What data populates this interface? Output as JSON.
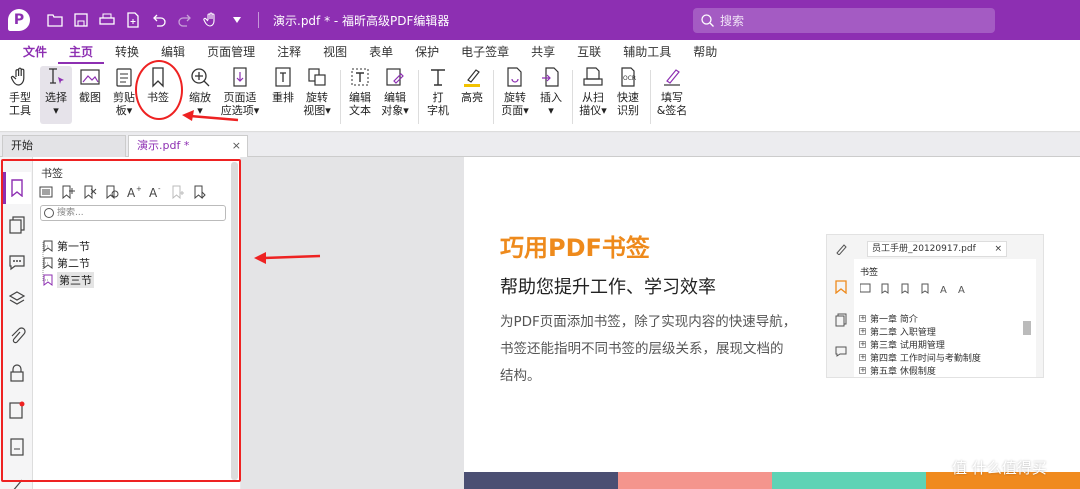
{
  "titlebar": {
    "logo": "P",
    "title": "演示.pdf * - 福昕高级PDF编辑器",
    "search_placeholder": "搜索"
  },
  "menu": [
    "文件",
    "主页",
    "转换",
    "编辑",
    "页面管理",
    "注释",
    "视图",
    "表单",
    "保护",
    "电子签章",
    "共享",
    "互联",
    "辅助工具",
    "帮助"
  ],
  "ribbon": {
    "hand": [
      "手型",
      "工具"
    ],
    "select": [
      "选择",
      "▾"
    ],
    "screenshot": "截图",
    "clipboard": [
      "剪贴",
      "板▾"
    ],
    "bookmark": "书签",
    "zoom": [
      "缩放",
      "▾"
    ],
    "fit": [
      "页面适",
      "应选项▾"
    ],
    "reflow": "重排",
    "rotate": [
      "旋转",
      "视图▾"
    ],
    "edit_text": [
      "编辑",
      "文本"
    ],
    "edit_obj": [
      "编辑",
      "对象▾"
    ],
    "typewriter": [
      "打",
      "字机"
    ],
    "highlight": "高亮",
    "rotate_page": [
      "旋转",
      "页面▾"
    ],
    "insert": [
      "插入",
      "▾"
    ],
    "scan": [
      "从扫",
      "描仪▾"
    ],
    "ocr": [
      "快速",
      "识别"
    ],
    "fill_sign": [
      "填写",
      "&签名"
    ]
  },
  "tabs": {
    "start": "开始",
    "doc": "演示.pdf *",
    "close": "×"
  },
  "panel": {
    "title": "书签",
    "search_placeholder": "搜索...",
    "bookmarks": [
      "第一节",
      "第二节",
      "第三节"
    ]
  },
  "document": {
    "heading": "巧用PDF书签",
    "subheading": "帮助您提升工作、学习效率",
    "paragraph": [
      "为PDF页面添加书签，除了实现内容的快速导航，",
      "书签还能指明不同书签的层级关系，展现文档的",
      "结构。"
    ]
  },
  "mini": {
    "tab": "员工手册_20120917.pdf",
    "panel_title": "书签",
    "rows": [
      "第一章 简介",
      "第二章 入职管理",
      "第三章 试用期管理",
      "第四章 工作时间与考勤制度",
      "第五章 休假制度"
    ]
  },
  "watermark": "值 什么值得买",
  "colors": {
    "brand": "#8d2fb2",
    "accent": "#ee8a1c",
    "annotation": "#e22222"
  }
}
